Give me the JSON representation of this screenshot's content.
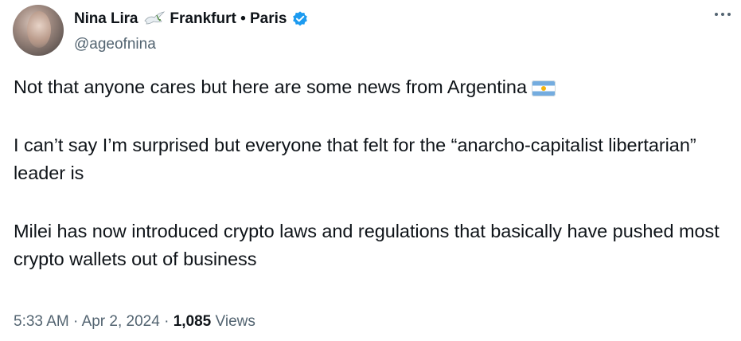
{
  "author": {
    "name": "Nina Lira",
    "name_emoji": "dove-icon",
    "location": "Frankfurt • Paris",
    "handle": "@ageofnina",
    "verified": true,
    "verified_color": "#1d9bf0"
  },
  "tweet": {
    "paragraphs": [
      "Not that anyone cares but here are some news from Argentina",
      "I can’t say I’m surprised but everyone that felt for the “anarcho-capitalist libertarian” leader is",
      "Milei has now introduced crypto laws and regulations that basically have pushed most crypto wallets out of business"
    ],
    "emoji_after_first": "argentina-flag-icon"
  },
  "meta": {
    "time": "5:33 AM",
    "separator": " · ",
    "date": "Apr 2, 2024",
    "views_count": "1,085",
    "views_label": " Views"
  },
  "icons": {
    "more": "more-options-icon"
  }
}
